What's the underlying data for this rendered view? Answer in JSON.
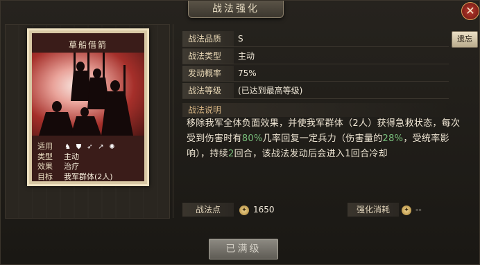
{
  "window": {
    "title": "战法强化",
    "close_label": "✕"
  },
  "card": {
    "name": "草船借箭",
    "stats": [
      {
        "key": "适用",
        "value": ""
      },
      {
        "key": "类型",
        "value": "主动"
      },
      {
        "key": "效果",
        "value": "治疗"
      },
      {
        "key": "目标",
        "value": "我军群体(2人)"
      }
    ],
    "troop_icons": [
      "cavalry-icon",
      "shield-icon",
      "bow-icon",
      "spear-icon",
      "chariot-icon"
    ]
  },
  "info": {
    "quality_label": "战法品质",
    "quality_value": "S",
    "type_label": "战法类型",
    "type_value": "主动",
    "rate_label": "发动概率",
    "rate_value": "75%",
    "level_label": "战法等级",
    "level_value": "(已达到最高等级)",
    "review_button": "遗忘"
  },
  "description": {
    "header": "战法说明",
    "part1": "移除我军全体负面效果，并使我军群体（2人）获得急救状态，每次受到伤害时有",
    "pct1": "80%",
    "part2": "几率回复一定兵力（伤害量的",
    "pct2": "28%",
    "part3": "，受统率影响），持续",
    "turns": "2",
    "part4": "回合，该战法发动后会进入1回合冷却"
  },
  "points": {
    "label": "战法点",
    "value": "1650",
    "cost_label": "强化消耗",
    "cost_value": "--"
  },
  "action_button": "已满级",
  "colors": {
    "highlight": "#79c07c",
    "title_text": "#e7dcc2",
    "close_red": "#b83a2e"
  }
}
